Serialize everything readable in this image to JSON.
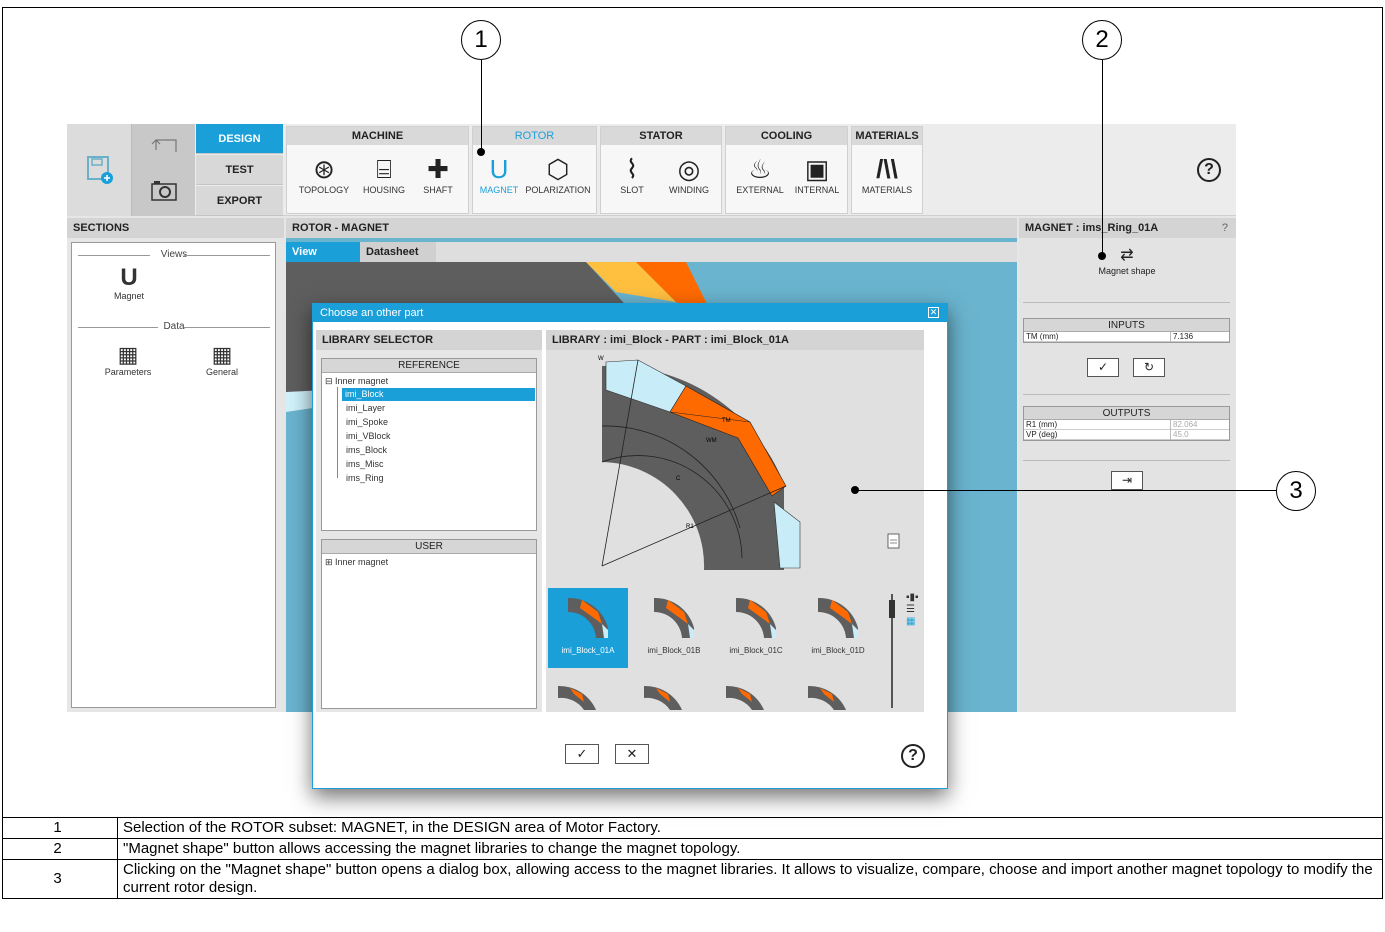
{
  "callouts": [
    "1",
    "2",
    "3"
  ],
  "ribbon": {
    "modes": [
      "DESIGN",
      "TEST",
      "EXPORT"
    ],
    "active_mode": "DESIGN",
    "groups": [
      {
        "title": "MACHINE",
        "items": [
          "TOPOLOGY",
          "HOUSING",
          "SHAFT"
        ]
      },
      {
        "title": "ROTOR",
        "items": [
          "MAGNET",
          "POLARIZATION"
        ]
      },
      {
        "title": "STATOR",
        "items": [
          "SLOT",
          "WINDING"
        ]
      },
      {
        "title": "COOLING",
        "items": [
          "EXTERNAL",
          "INTERNAL"
        ]
      },
      {
        "title": "MATERIALS",
        "items": [
          "MATERIALS"
        ]
      }
    ],
    "active_group": "ROTOR",
    "active_item": "MAGNET",
    "help": "?"
  },
  "sections": {
    "title": "SECTIONS",
    "views_label": "Views",
    "data_label": "Data",
    "views": [
      "Magnet"
    ],
    "data": [
      "Parameters",
      "General"
    ]
  },
  "center": {
    "title": "ROTOR - MAGNET",
    "tabs": [
      "View",
      "Datasheet"
    ],
    "active_tab": "View"
  },
  "right_panel": {
    "title": "MAGNET : ims_Ring_01A",
    "help": "?",
    "magnet_shape_label": "Magnet shape",
    "inputs": {
      "title": "INPUTS",
      "rows": [
        {
          "name": "TM (mm)",
          "value": "7.136"
        }
      ]
    },
    "outputs": {
      "title": "OUTPUTS",
      "rows": [
        {
          "name": "R1 (mm)",
          "value": "82.064"
        },
        {
          "name": "VP (deg)",
          "value": "45.0"
        }
      ]
    }
  },
  "dialog": {
    "title": "Choose an other part",
    "library_selector": "LIBRARY SELECTOR",
    "reference_label": "REFERENCE",
    "user_label": "USER",
    "reference_root": "⊟ Inner magnet",
    "reference_items": [
      "imi_Block",
      "imi_Layer",
      "imi_Spoke",
      "imi_VBlock",
      "ims_Block",
      "ims_Misc",
      "ims_Ring"
    ],
    "selected_item": "imi_Block",
    "user_root": "⊞ Inner magnet",
    "preview_header": "LIBRARY : imi_Block   -   PART : imi_Block_01A",
    "dimension_labels": [
      "W",
      "TM",
      "WM",
      "C",
      "R1"
    ],
    "thumbnails": [
      "imi_Block_01A",
      "imi_Block_01B",
      "imi_Block_01C",
      "imi_Block_01D"
    ],
    "selected_thumbnail": "imi_Block_01A",
    "help": "?"
  },
  "colors": {
    "accent": "#1a9fd9",
    "magnet_orange": "#ff6a00",
    "rotor_grey": "#5e5e5e",
    "airgap_lightblue": "#c8ecf8",
    "view_background": "#6ab4cf"
  },
  "legend": [
    {
      "num": "1",
      "text": "Selection of the ROTOR subset: MAGNET, in the DESIGN area of Motor Factory."
    },
    {
      "num": "2",
      "text": "\"Magnet shape\" button allows accessing the magnet libraries to change the magnet topology."
    },
    {
      "num": "3",
      "text": "Clicking on the \"Magnet shape\" button opens a dialog box, allowing access to the magnet libraries. It allows to visualize, compare, choose and import another magnet topology to modify the current rotor design."
    }
  ]
}
